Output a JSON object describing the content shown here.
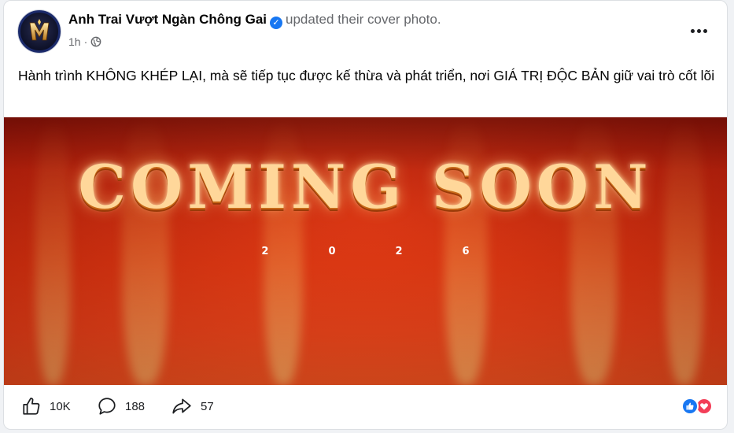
{
  "post": {
    "page_name": "Anh Trai Vượt Ngàn Chông Gai",
    "action": "updated their cover photo.",
    "time": "1h",
    "separator": "·",
    "caption": "Hành trình KHÔNG KHÉP LẠI, mà sẽ tiếp tục được kế thừa và phát triển, nơi GIÁ TRỊ ĐỘC BẢN giữ vai trò cốt lõi"
  },
  "cover": {
    "headline": "COMING SOON",
    "year": "2026"
  },
  "footer": {
    "likes": "10K",
    "comments": "188",
    "shares": "57"
  },
  "icons": {
    "verified": "verified-badge-icon",
    "privacy": "globe-icon",
    "more": "more-options-icon",
    "like": "thumbs-up-icon",
    "comment": "comment-bubble-icon",
    "share": "share-arrow-icon",
    "reaction_like": "like-reaction-icon",
    "reaction_love": "love-reaction-icon"
  },
  "colors": {
    "facebook_blue": "#1877f2",
    "love_red": "#f33e58",
    "secondary_text": "#65676b"
  }
}
